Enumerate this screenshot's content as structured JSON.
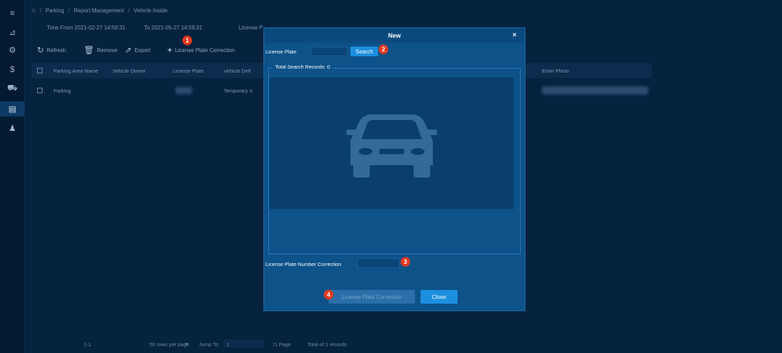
{
  "breadcrumb": {
    "items": [
      "Parking",
      "Report Management",
      "Vehicle Inside"
    ],
    "separator": "/"
  },
  "filters": {
    "time_from": "Time From 2021-02-27 14:59:31",
    "to": "To 2021-05-27 14:59:31",
    "license": "License P"
  },
  "toolbar": {
    "refresh": "Refresh",
    "remove": "Remove",
    "export": "Export",
    "correction": "License Plate Correction"
  },
  "table": {
    "headers": [
      "Parking Area Name",
      "Vehicle Owner",
      "License Plate",
      "Vehicle Defi",
      "Enter Photo"
    ],
    "rows": [
      {
        "area": "Parking",
        "vehicle_def": "Temporary V"
      }
    ]
  },
  "pagination": {
    "range": "1-1",
    "rows_per_page": "50 rows per page",
    "jump_to": "Jump To",
    "page_input": "1",
    "page_suffix": "/1 Page",
    "total": "Total of 1 records"
  },
  "modal": {
    "title": "New",
    "close_icon": "×",
    "plate_label": "License Plate",
    "search_button": "Search",
    "records_legend": "Total Search Records: 0",
    "correction_label": "License Plate Number Correction",
    "correction_button": "License Plate Correction",
    "close_button": "Close"
  },
  "markers": [
    "1",
    "2",
    "3",
    "4"
  ],
  "colors": {
    "background": "#05223f",
    "modal": "#0d5289",
    "primary_button": "#1d8fe0",
    "marker": "#e5391f"
  }
}
